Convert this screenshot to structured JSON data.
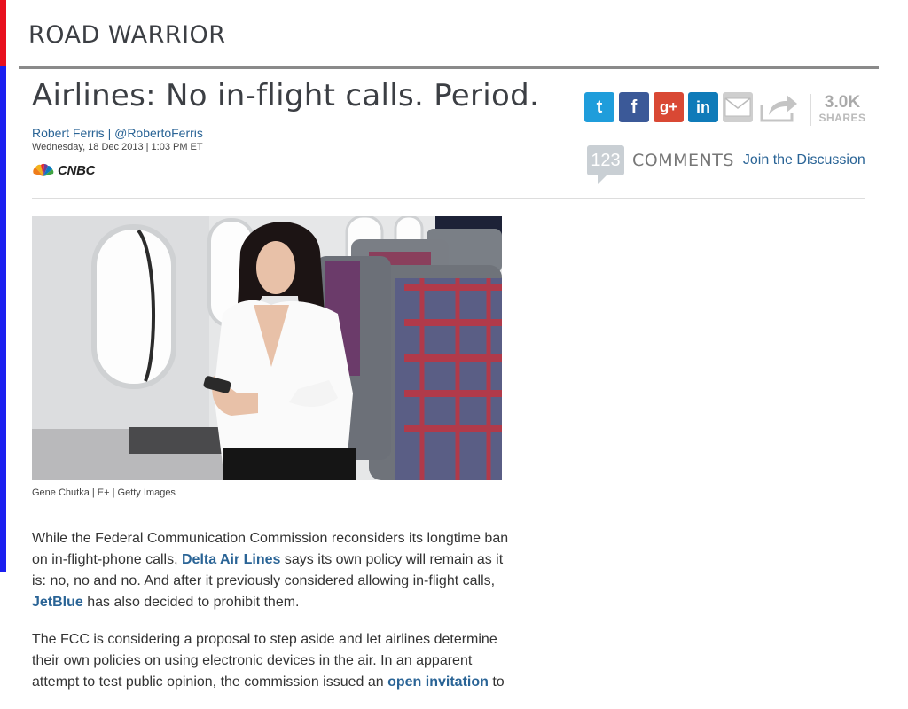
{
  "section": {
    "title": "ROAD WARRIOR"
  },
  "article": {
    "headline": "Airlines: No in-flight calls. Period.",
    "author": "Robert Ferris",
    "author_handle": "@RobertoFerris",
    "byline_separator": "|",
    "date": "Wednesday, 18 Dec 2013 | 1:03 PM ET",
    "source_logo_text": "CNBC",
    "photo_caption": "Gene Chutka | E+ | Getty Images"
  },
  "share": {
    "icons": [
      "twitter-icon",
      "facebook-icon",
      "google-plus-icon",
      "linkedin-icon",
      "email-icon",
      "share-icon"
    ],
    "twitter_glyph": "t",
    "facebook_glyph": "f",
    "gplus_glyph": "g+",
    "linkedin_glyph": "in",
    "count": "3.0K",
    "count_label": "SHARES"
  },
  "comments": {
    "count": "123",
    "label": "COMMENTS",
    "join_link": "Join the Discussion"
  },
  "body": {
    "p1_a": "While the Federal Communication Commission reconsiders its longtime ban on in-flight-phone calls, ",
    "p1_link1": "Delta Air Lines",
    "p1_b": " says its own policy will remain as it is: no, no and no. And after it previously considered allowing in-flight calls, ",
    "p1_link2": "JetBlue",
    "p1_c": " has also decided to prohibit them.",
    "p2_a": "The FCC is considering a proposal to step aside and let airlines determine their own policies on using electronic devices in the air. In an apparent attempt to test public opinion, the commission issued an ",
    "p2_link": "open invitation",
    "p2_b": " to"
  },
  "colors": {
    "accent_red": "#e8101e",
    "accent_blue": "#1a1ff0",
    "link": "#2a6496",
    "twitter": "#1f9ddb",
    "facebook": "#3b5998",
    "gplus": "#d94834",
    "linkedin": "#0f7bb9"
  }
}
